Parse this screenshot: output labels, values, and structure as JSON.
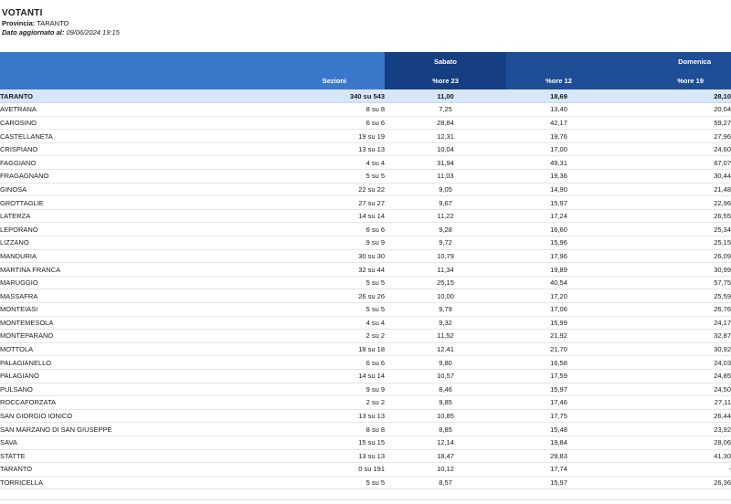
{
  "header": {
    "title": "VOTANTI",
    "province_label": "Provincia:",
    "province_value": "TARANTO",
    "updated_label": "Dato aggiornato al:",
    "updated_value": "09/06/2024 19:15"
  },
  "table": {
    "group_headers": {
      "sabato": "Sabato",
      "domenica": "Domenica"
    },
    "columns": {
      "sezioni": "Sezioni",
      "ore23": "%ore 23",
      "ore12": "%ore 12",
      "ore19": "%ore 19"
    },
    "total": {
      "name": "TARANTO",
      "sezioni": "340 su 543",
      "ore23": "11,00",
      "ore12": "18,69",
      "ore19": "28,10"
    },
    "rows": [
      {
        "name": "AVETRANA",
        "sezioni": "8 su 8",
        "ore23": "7,25",
        "ore12": "13,40",
        "ore19": "20,04"
      },
      {
        "name": "CAROSINO",
        "sezioni": "6 su 6",
        "ore23": "28,84",
        "ore12": "42,17",
        "ore19": "59,27"
      },
      {
        "name": "CASTELLANETA",
        "sezioni": "19 su 19",
        "ore23": "12,31",
        "ore12": "19,76",
        "ore19": "27,96"
      },
      {
        "name": "CRISPIANO",
        "sezioni": "13 su 13",
        "ore23": "10,04",
        "ore12": "17,00",
        "ore19": "24,60"
      },
      {
        "name": "FAGGIANO",
        "sezioni": "4 su 4",
        "ore23": "31,94",
        "ore12": "49,31",
        "ore19": "67,07"
      },
      {
        "name": "FRAGAGNANO",
        "sezioni": "5 su 5",
        "ore23": "11,03",
        "ore12": "19,36",
        "ore19": "30,44"
      },
      {
        "name": "GINOSA",
        "sezioni": "22 su 22",
        "ore23": "9,05",
        "ore12": "14,90",
        "ore19": "21,48"
      },
      {
        "name": "GROTTAGLIE",
        "sezioni": "27 su 27",
        "ore23": "9,67",
        "ore12": "15,97",
        "ore19": "22,96"
      },
      {
        "name": "LATERZA",
        "sezioni": "14 su 14",
        "ore23": "11,22",
        "ore12": "17,24",
        "ore19": "26,55"
      },
      {
        "name": "LEPORANO",
        "sezioni": "6 su 6",
        "ore23": "9,28",
        "ore12": "16,60",
        "ore19": "25,34"
      },
      {
        "name": "LIZZANO",
        "sezioni": "9 su 9",
        "ore23": "9,72",
        "ore12": "15,96",
        "ore19": "25,15"
      },
      {
        "name": "MANDURIA",
        "sezioni": "30 su 30",
        "ore23": "10,79",
        "ore12": "17,96",
        "ore19": "26,09"
      },
      {
        "name": "MARTINA FRANCA",
        "sezioni": "32 su 44",
        "ore23": "11,34",
        "ore12": "19,89",
        "ore19": "30,99"
      },
      {
        "name": "MARUGGIO",
        "sezioni": "5 su 5",
        "ore23": "25,15",
        "ore12": "40,54",
        "ore19": "57,75"
      },
      {
        "name": "MASSAFRA",
        "sezioni": "26 su 26",
        "ore23": "10,00",
        "ore12": "17,20",
        "ore19": "25,59"
      },
      {
        "name": "MONTEIASI",
        "sezioni": "5 su 5",
        "ore23": "9,79",
        "ore12": "17,06",
        "ore19": "26,76"
      },
      {
        "name": "MONTEMESOLA",
        "sezioni": "4 su 4",
        "ore23": "9,32",
        "ore12": "15,99",
        "ore19": "24,17"
      },
      {
        "name": "MONTEPARANO",
        "sezioni": "2 su 2",
        "ore23": "11,52",
        "ore12": "21,92",
        "ore19": "32,87"
      },
      {
        "name": "MOTTOLA",
        "sezioni": "18 su 18",
        "ore23": "12,41",
        "ore12": "21,70",
        "ore19": "30,92"
      },
      {
        "name": "PALAGIANELLO",
        "sezioni": "6 su 6",
        "ore23": "9,80",
        "ore12": "16,58",
        "ore19": "24,03"
      },
      {
        "name": "PALAGIANO",
        "sezioni": "14 su 14",
        "ore23": "10,57",
        "ore12": "17,59",
        "ore19": "24,85"
      },
      {
        "name": "PULSANO",
        "sezioni": "9 su 9",
        "ore23": "8,46",
        "ore12": "15,97",
        "ore19": "24,50"
      },
      {
        "name": "ROCCAFORZATA",
        "sezioni": "2 su 2",
        "ore23": "9,85",
        "ore12": "17,46",
        "ore19": "27,11"
      },
      {
        "name": "SAN GIORGIO IONICO",
        "sezioni": "13 su 13",
        "ore23": "10,85",
        "ore12": "17,75",
        "ore19": "26,44"
      },
      {
        "name": "SAN MARZANO DI SAN GIUSEPPE",
        "sezioni": "8 su 8",
        "ore23": "8,85",
        "ore12": "15,48",
        "ore19": "23,92"
      },
      {
        "name": "SAVA",
        "sezioni": "15 su 15",
        "ore23": "12,14",
        "ore12": "19,84",
        "ore19": "28,06"
      },
      {
        "name": "STATTE",
        "sezioni": "13 su 13",
        "ore23": "18,47",
        "ore12": "29,83",
        "ore19": "41,30"
      },
      {
        "name": "TARANTO",
        "sezioni": "0 su 191",
        "ore23": "10,12",
        "ore12": "17,74",
        "ore19": "-"
      },
      {
        "name": "TORRICELLA",
        "sezioni": "5 su 5",
        "ore23": "8,57",
        "ore12": "15,97",
        "ore19": "26,36"
      }
    ]
  }
}
